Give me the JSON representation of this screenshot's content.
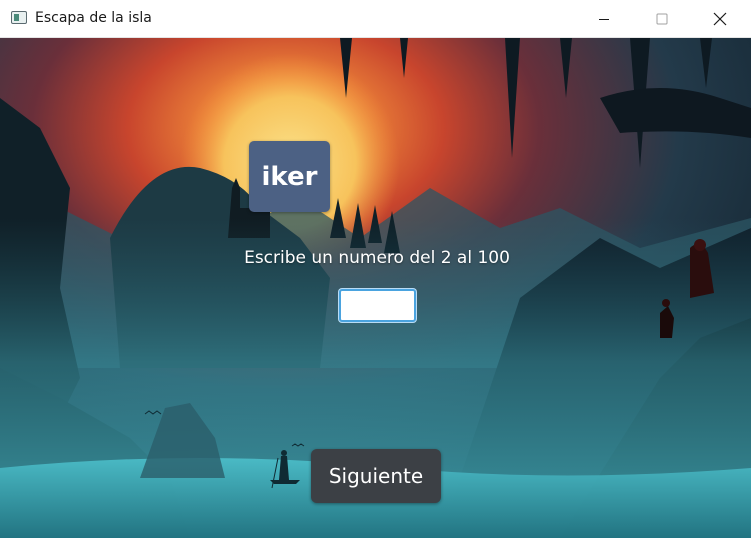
{
  "window": {
    "title": "Escapa de la isla",
    "app_icon": "app-window-icon",
    "controls": {
      "minimize_icon": "minimize-icon",
      "maximize_icon": "maximize-icon",
      "close_icon": "close-icon"
    }
  },
  "main": {
    "player_name": "iker",
    "prompt": "Escribe un numero del 2 al 100",
    "number_input_value": "",
    "next_button_label": "Siguiente"
  },
  "colors": {
    "badge_bg": "#4c6184",
    "button_bg": "#3c4045",
    "input_focus": "#4aa3df"
  }
}
